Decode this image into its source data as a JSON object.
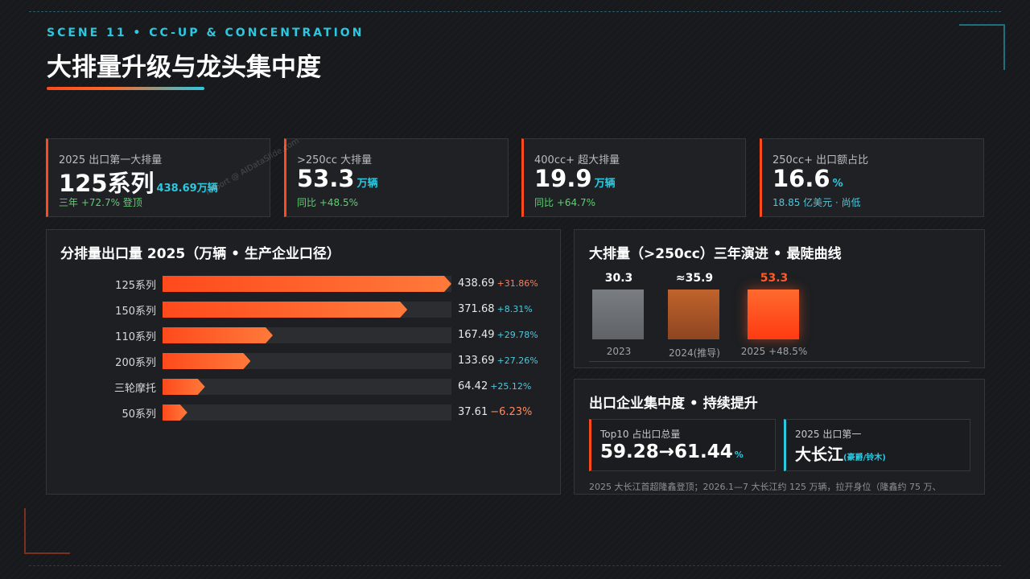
{
  "header": {
    "scene": "SCENE 11 • CC-UP & CONCENTRATION",
    "title": "大排量升级与龙头集中度"
  },
  "kpis": [
    {
      "label": "2025 出口第一大排量",
      "value": "125系列",
      "unit": "438.69万辆",
      "sub": "三年 +72.7% 登顶"
    },
    {
      "label": ">250cc 大排量",
      "value": "53.3",
      "unit": "万辆",
      "sub": "同比 +48.5%"
    },
    {
      "label": "400cc+ 超大排量",
      "value": "19.9",
      "unit": "万辆",
      "sub": "同比 +64.7%"
    },
    {
      "label": "250cc+ 出口额占比",
      "value": "16.6",
      "unit": "%",
      "sub": "18.85 亿美元 · 尚低"
    }
  ],
  "watermark": "Report @ AIDataSlide.com",
  "bar_panel": {
    "title": "分排量出口量 2025（万辆 • 生产企业口径）"
  },
  "chart_data": [
    {
      "type": "bar",
      "orientation": "horizontal",
      "categories": [
        "125系列",
        "150系列",
        "110系列",
        "200系列",
        "三轮摩托",
        "50系列"
      ],
      "values": [
        438.69,
        371.68,
        167.49,
        133.69,
        64.42,
        37.61
      ],
      "value_labels": [
        "438.69",
        "371.68",
        "167.49",
        "133.69",
        "64.42",
        "37.61"
      ],
      "changes": [
        "+31.86%",
        "+8.31%",
        "+29.78%",
        "+27.26%",
        "+25.12%",
        "−6.23%"
      ],
      "title": "分排量出口量 2025（万辆 • 生产企业口径）",
      "xlim": [
        0,
        438.69
      ]
    },
    {
      "type": "bar",
      "categories": [
        "2023",
        "2024(推导)",
        "2025 +48.5%"
      ],
      "values": [
        30.3,
        35.9,
        53.3
      ],
      "value_labels": [
        "30.3",
        "≈35.9",
        "53.3"
      ],
      "title": "大排量（>250cc）三年演进 • 最陡曲线"
    }
  ],
  "concentration": {
    "title": "出口企业集中度 • 持续提升",
    "top10_label": "Top10 占出口总量",
    "top10_value": "59.28→61.44",
    "top10_unit": "%",
    "first_label": "2025 出口第一",
    "first_value": "大长江",
    "first_sub": "(豪爵/铃木)",
    "note": "2025 大长江首超隆鑫登顶；2026.1—7 大长江约 125 万辆，拉开身位（隆鑫约 75 万、"
  },
  "colors": {
    "accent": "#ff4a1c",
    "cyan": "#2cc8e0",
    "bg": "#17191c",
    "bar_2023": "#6b6e73",
    "bar_2024": "#b05a2a"
  }
}
